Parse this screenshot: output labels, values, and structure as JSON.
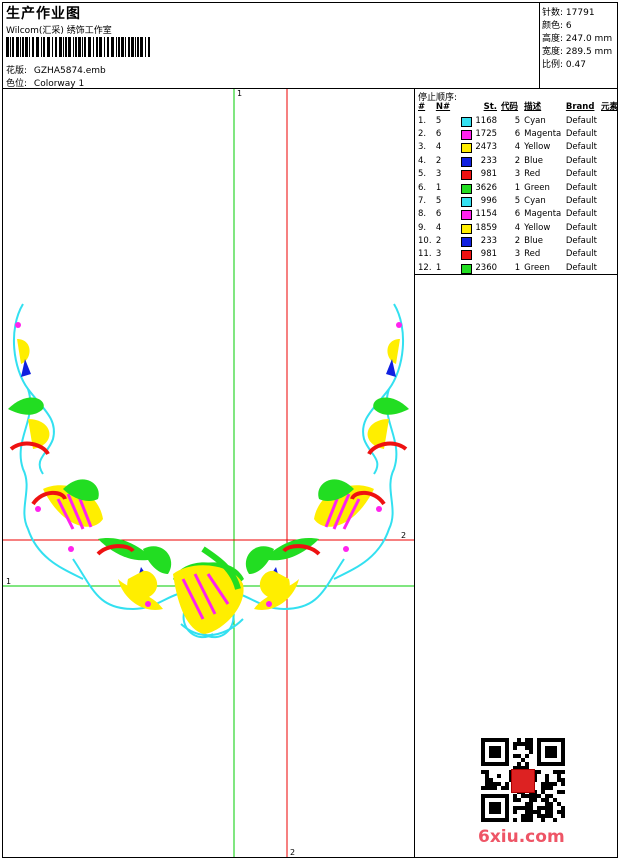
{
  "header": {
    "title": "生产作业图",
    "company": "Wilcom(汇采) 绣饰工作室",
    "pattern_label": "花版:",
    "pattern_value": "GZHA5874.emb",
    "colorway_label": "色位:",
    "colorway_value": "Colorway 1"
  },
  "stats": [
    {
      "label": "针数:",
      "value": "17791"
    },
    {
      "label": "颜色:",
      "value": "6"
    },
    {
      "label": "高度:",
      "value": "247.0 mm"
    },
    {
      "label": "宽度:",
      "value": "289.5 mm"
    },
    {
      "label": "比例:",
      "value": "0.47"
    }
  ],
  "stop_sequence": {
    "title": "停止顺序:",
    "headers": [
      "#",
      "N#",
      "St.",
      "代码",
      "描述",
      "Brand",
      "元素"
    ],
    "rows": [
      {
        "idx": "1.",
        "n": "5",
        "color": "#33e0f0",
        "st": "1168",
        "code": "5",
        "desc": "Cyan",
        "brand": "Default"
      },
      {
        "idx": "2.",
        "n": "6",
        "color": "#ff22ee",
        "st": "1725",
        "code": "6",
        "desc": "Magenta",
        "brand": "Default"
      },
      {
        "idx": "3.",
        "n": "4",
        "color": "#ffee00",
        "st": "2473",
        "code": "4",
        "desc": "Yellow",
        "brand": "Default"
      },
      {
        "idx": "4.",
        "n": "2",
        "color": "#1020e0",
        "st": "233",
        "code": "2",
        "desc": "Blue",
        "brand": "Default"
      },
      {
        "idx": "5.",
        "n": "3",
        "color": "#ee1111",
        "st": "981",
        "code": "3",
        "desc": "Red",
        "brand": "Default"
      },
      {
        "idx": "6.",
        "n": "1",
        "color": "#22dd22",
        "st": "3626",
        "code": "1",
        "desc": "Green",
        "brand": "Default"
      },
      {
        "idx": "7.",
        "n": "5",
        "color": "#33e0f0",
        "st": "996",
        "code": "5",
        "desc": "Cyan",
        "brand": "Default"
      },
      {
        "idx": "8.",
        "n": "6",
        "color": "#ff22ee",
        "st": "1154",
        "code": "6",
        "desc": "Magenta",
        "brand": "Default"
      },
      {
        "idx": "9.",
        "n": "4",
        "color": "#ffee00",
        "st": "1859",
        "code": "4",
        "desc": "Yellow",
        "brand": "Default"
      },
      {
        "idx": "10.",
        "n": "2",
        "color": "#1020e0",
        "st": "233",
        "code": "2",
        "desc": "Blue",
        "brand": "Default"
      },
      {
        "idx": "11.",
        "n": "3",
        "color": "#ee1111",
        "st": "981",
        "code": "3",
        "desc": "Red",
        "brand": "Default"
      },
      {
        "idx": "12.",
        "n": "1",
        "color": "#22dd22",
        "st": "2360",
        "code": "1",
        "desc": "Green",
        "brand": "Default"
      }
    ]
  },
  "canvas": {
    "guide_green_label_top": "1",
    "guide_green_label_left": "1",
    "guide_red_label_right": "2",
    "guide_red_label_bottom": "2",
    "green_color": "#00cc00",
    "red_color": "#ee0000"
  },
  "watermark": "6xiu.com"
}
